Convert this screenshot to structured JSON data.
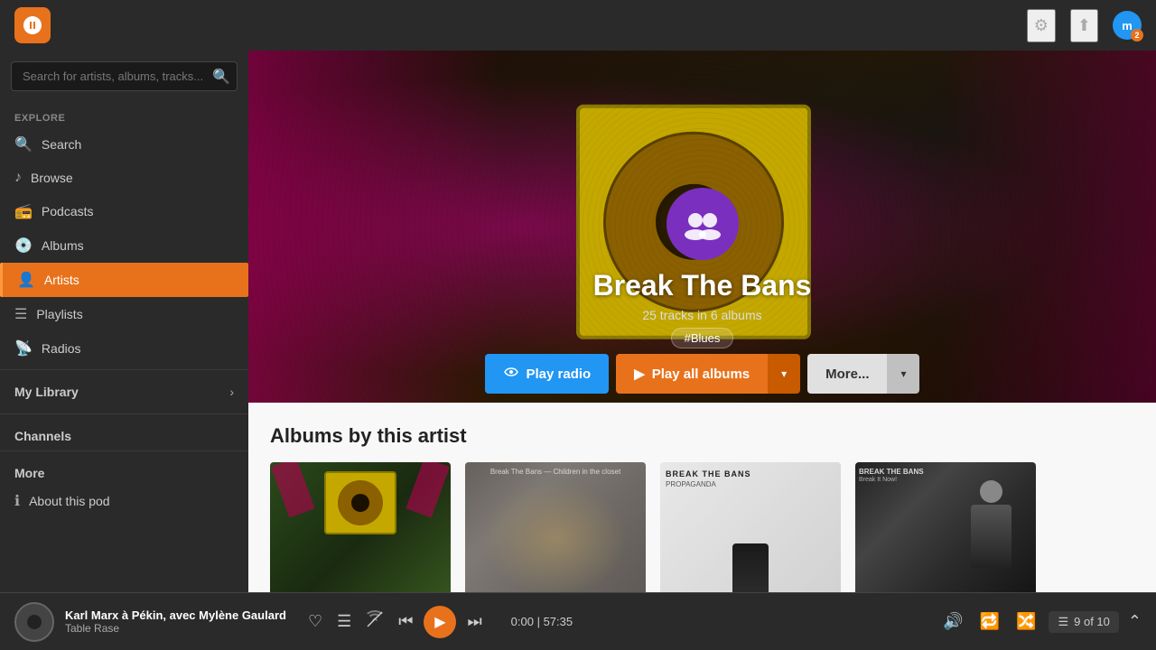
{
  "topbar": {
    "logo_symbol": "🎵",
    "settings_icon": "⚙",
    "upload_icon": "⬆",
    "avatar_label": "m",
    "avatar_badge": "2"
  },
  "sidebar": {
    "search_placeholder": "Search for artists, albums, tracks...",
    "explore_label": "Explore",
    "nav_items": [
      {
        "id": "search",
        "label": "Search",
        "icon": "🔍"
      },
      {
        "id": "browse",
        "label": "Browse",
        "icon": "♪"
      },
      {
        "id": "podcasts",
        "label": "Podcasts",
        "icon": "📻"
      },
      {
        "id": "albums",
        "label": "Albums",
        "icon": "💿"
      },
      {
        "id": "artists",
        "label": "Artists",
        "icon": "👤"
      },
      {
        "id": "playlists",
        "label": "Playlists",
        "icon": "☰"
      },
      {
        "id": "radios",
        "label": "Radios",
        "icon": "📡"
      }
    ],
    "my_library_label": "My Library",
    "channels_label": "Channels",
    "more_label": "More",
    "about_label": "About this pod",
    "about_icon": "ℹ"
  },
  "artist": {
    "name": "Break The Bans",
    "tracks_info": "25 tracks in 6 albums",
    "genre_tag": "#Blues",
    "btn_play_radio": "Play radio",
    "btn_play_all": "Play all albums",
    "btn_more": "More...",
    "avatar_symbol": "👥"
  },
  "albums_section": {
    "title": "Albums by this artist",
    "albums": [
      {
        "id": 1,
        "style": "art1"
      },
      {
        "id": 2,
        "style": "art2"
      },
      {
        "id": 3,
        "style": "art3"
      },
      {
        "id": 4,
        "style": "art4"
      }
    ]
  },
  "player": {
    "track_title": "Karl Marx à Pékin, avec Mylène Gaulard",
    "track_subtitle": "Table Rase",
    "time_current": "0:00",
    "time_total": "57:35",
    "queue_info": "9 of 10"
  }
}
